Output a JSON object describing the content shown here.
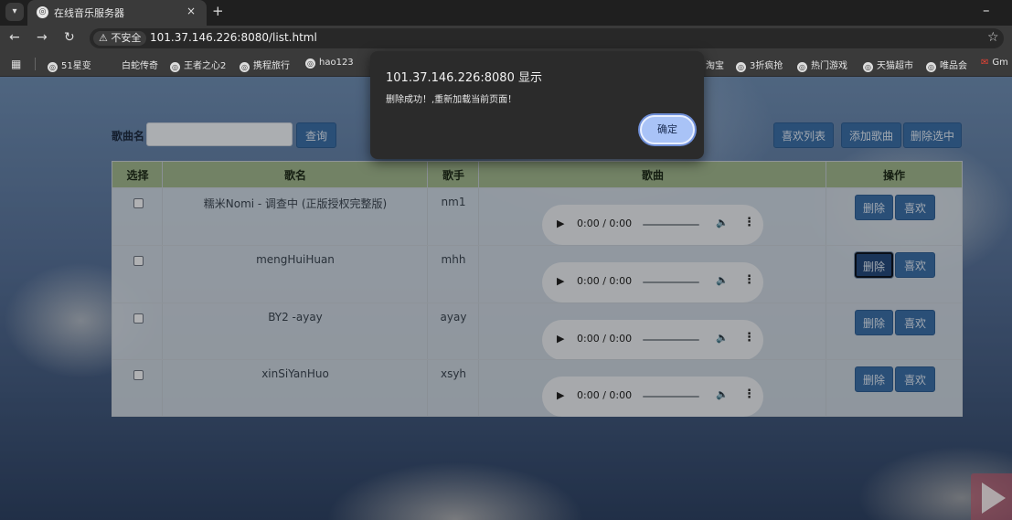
{
  "browser": {
    "tab_title": "在线音乐服务器",
    "tab_close": "×",
    "new_tab": "+",
    "minimize": "–",
    "insecure_label": "⚠ 不安全",
    "url": "101.37.146.226:8080/list.html",
    "bookmarks": [
      "51星变",
      "白蛇传奇",
      "王者之心2",
      "携程旅行",
      "hao123",
      "淘宝",
      "3折疯抢",
      "热门游戏",
      "天猫超市",
      "唯品会",
      "Gm"
    ]
  },
  "page": {
    "search_label": "歌曲名",
    "search_value": "",
    "search_button": "查询",
    "favorites_button": "喜欢列表",
    "add_button": "添加歌曲",
    "delete_selected_button": "删除选中",
    "table": {
      "headers": [
        "选择",
        "歌名",
        "歌手",
        "歌曲",
        "操作"
      ],
      "rows": [
        {
          "name": "糯米Nomi - 调查中 (正版授权完整版)",
          "singer": "nm1",
          "time": "0:00 / 0:00",
          "delete": "删除",
          "like": "喜欢"
        },
        {
          "name": "mengHuiHuan",
          "singer": "mhh",
          "time": "0:00 / 0:00",
          "delete": "删除",
          "like": "喜欢"
        },
        {
          "name": "BY2 -ayay",
          "singer": "ayay",
          "time": "0:00 / 0:00",
          "delete": "删除",
          "like": "喜欢"
        },
        {
          "name": "xinSiYanHuo",
          "singer": "xsyh",
          "time": "0:00 / 0:00",
          "delete": "删除",
          "like": "喜欢"
        }
      ]
    }
  },
  "dialog": {
    "title": "101.37.146.226:8080 显示",
    "message": "删除成功！,重新加载当前页面！",
    "ok_button": "确定"
  },
  "icons": {
    "back": "back-arrow-icon",
    "forward": "forward-arrow-icon",
    "reload": "reload-icon",
    "star": "bookmark-star-icon",
    "play": "play-icon",
    "volume": "volume-icon",
    "more": "more-vertical-icon"
  },
  "colors": {
    "accent_button": "#3b6ea6",
    "table_header": "#9eb58c",
    "dialog_bg": "#2b2b2b",
    "dialog_ok": "#a9c3f7"
  }
}
